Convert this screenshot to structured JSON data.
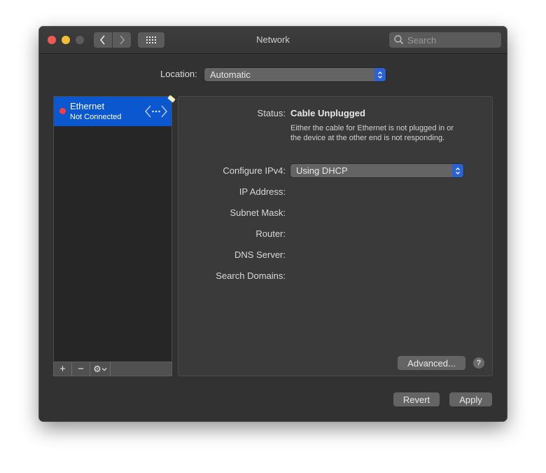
{
  "window": {
    "title": "Network",
    "search": {
      "placeholder": "Search",
      "value": ""
    }
  },
  "location": {
    "label": "Location:",
    "selected": "Automatic"
  },
  "services": [
    {
      "name": "Ethernet",
      "status": "Not Connected",
      "status_color": "#ff3b42",
      "selected": true
    }
  ],
  "sidebar_toolbar": {
    "add": "+",
    "remove": "−",
    "action": "⚙"
  },
  "detail": {
    "status_label": "Status:",
    "status_value": "Cable Unplugged",
    "status_description": "Either the cable for Ethernet is not plugged in or the device at the other end is not responding.",
    "configure_ipv4_label": "Configure IPv4:",
    "configure_ipv4_value": "Using DHCP",
    "fields": [
      {
        "label": "IP Address:",
        "value": ""
      },
      {
        "label": "Subnet Mask:",
        "value": ""
      },
      {
        "label": "Router:",
        "value": ""
      },
      {
        "label": "DNS Server:",
        "value": ""
      },
      {
        "label": "Search Domains:",
        "value": ""
      }
    ],
    "advanced_label": "Advanced...",
    "help_label": "?"
  },
  "footer": {
    "revert_label": "Revert",
    "apply_label": "Apply"
  },
  "colors": {
    "accent": "#0a57d0",
    "stepper": "#2a62d6",
    "close": "#ee5a53",
    "minimize": "#f4bd39"
  }
}
